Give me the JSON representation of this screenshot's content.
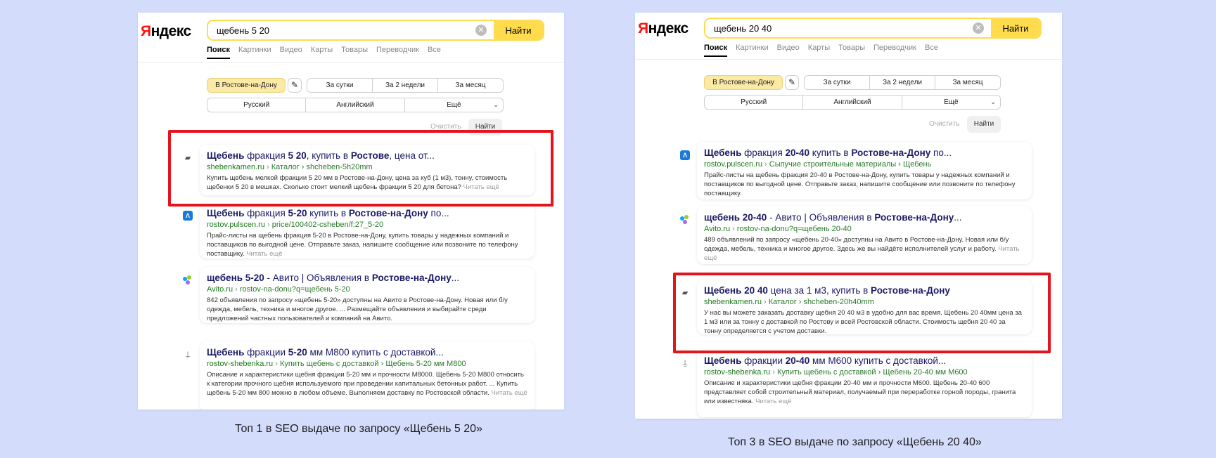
{
  "left": {
    "logo": "Яндекс",
    "search_value": "щебень 5 20",
    "search_button": "Найти",
    "tabs": [
      "Поиск",
      "Картинки",
      "Видео",
      "Карты",
      "Товары",
      "Переводчик",
      "Все"
    ],
    "filters": {
      "region": "В Ростове-на-Дону",
      "periods": [
        "За сутки",
        "За 2 недели",
        "За месяц"
      ],
      "languages": [
        "Русский",
        "Английский",
        "Ещё"
      ],
      "clear": "Очистить",
      "find": "Найти"
    },
    "results": [
      {
        "title": "Щебень фракция 5 20, купить в Ростове, цена от...",
        "site": "shebenkamen.ru",
        "path": "Каталог › shcheben-5h20mm",
        "snippet": "Купить щебень мелкой фракции 5 20 мм в Ростове-на-Дону, цена за куб (1 м3), тонну, стоимость щебенки 5 20 в мешках. Сколько стоит мелкий щебень фракции 5 20 для бетона?",
        "more": "Читать ещё"
      },
      {
        "title": "Щебень фракция 5-20 купить в Ростове-на-Дону по...",
        "site": "rostov.pulscen.ru",
        "path": "price/100402-csheben/f:27_5-20",
        "snippet": "Прайс-листы на щебень фракция 5-20 в Ростове-на-Дону, купить товары у надежных компаний и поставщиков по выгодной цене. Отправьте заказ, напишите сообщение или позвоните по телефону поставщику.",
        "more": "Читать ещё"
      },
      {
        "title": "щебень 5-20 - Авито | Объявления в Ростове-на-Дону...",
        "site": "Avito.ru",
        "path": "rostov-na-donu?q=щебень 5-20",
        "snippet": "842 объявления по запросу «щебень 5-20» доступны на Авито в Ростове-на-Дону. Новая или б/у одежда, мебель, техника и многое другое. ... Размещайте объявления и выбирайте среди предложений частных пользователей и компаний на Авито.",
        "more": ""
      },
      {
        "title": "Щебень фракции 5-20 мм М800 купить с доставкой...",
        "site": "rostov-shebenka.ru",
        "path": "Купить щебень с доставкой › Щебень 5-20 мм М800",
        "snippet": "Описание и характеристики щебня фракции 5-20 мм и прочности М8000. Щебень 5-20 М800 относить к категории прочного щебня используемого при проведении капитальных бетонных работ. ... Купить щебень 5-20 мм 800 можно в любом объеме. Выполняем доставку по Ростовской области.",
        "more": "Читать ещё"
      }
    ],
    "caption": "Топ 1 в SEO выдаче по запросу «Щебень 5 20»"
  },
  "right": {
    "logo": "Яндекс",
    "search_value": "щебень 20 40",
    "search_button": "Найти",
    "tabs": [
      "Поиск",
      "Картинки",
      "Видео",
      "Карты",
      "Товары",
      "Переводчик",
      "Все"
    ],
    "filters": {
      "region": "В Ростове-на-Дону",
      "periods": [
        "За сутки",
        "За 2 недели",
        "За месяц"
      ],
      "languages": [
        "Русский",
        "Английский",
        "Ещё"
      ],
      "clear": "Очистить",
      "find": "Найти"
    },
    "results": [
      {
        "title": "Щебень фракция 20-40 купить в Ростове-на-Дону по...",
        "site": "rostov.pulscen.ru",
        "path": "Сыпучие строительные материалы › Щебень",
        "snippet": "Прайс-листы на щебень фракция 20-40 в Ростове-на-Дону, купить товары у надежных компаний и поставщиков по выгодной цене. Отправьте заказ, напишите сообщение или позвоните по телефону поставщику.",
        "more": ""
      },
      {
        "title": "щебень 20-40 - Авито | Объявления в Ростове-на-Дону...",
        "site": "Avito.ru",
        "path": "rostov-na-donu?q=щебень 20-40",
        "snippet": "489 объявлений по запросу «щебень 20-40» доступны на Авито в Ростове-на-Дону. Новая или б/у одежда, мебель, техника и многое другое. Здесь же вы найдёте исполнителей услуг и работу.",
        "more": "Читать ещё"
      },
      {
        "title": "Щебень 20 40 цена за 1 м3, купить в Ростове-на-Дону",
        "site": "shebenkamen.ru",
        "path": "Каталог › shcheben-20h40mm",
        "snippet": "У нас вы можете заказать доставку щебня 20 40 м3 в удобно для вас время. Щебень 20 40мм цена за 1 м3 или за тонну с доставкой по Ростову и всей Ростовской области. Стоимость щебня 20 40 за тонну определяется с учетом доставки.",
        "more": ""
      },
      {
        "title": "Щебень фракции 20-40 мм М600 купить с доставкой...",
        "site": "rostov-shebenka.ru",
        "path": "Купить щебень с доставкой › Щебень 20-40 мм М600",
        "snippet": "Описание и характеристики щебня фракции 20-40 мм и прочности М600. Щебень 20-40 600 представляет собой строительный материал, получаемый при переработке горной породы, гранита или известняка.",
        "more": "Читать ещё"
      }
    ],
    "caption": "Топ 3 в SEO выдаче по запросу «Щебень 20 40»"
  },
  "colors": {
    "background": "#d3dcfb",
    "highlight": "#e3141b",
    "search_accent": "#ffdb4d",
    "title": "#1a1a66",
    "url": "#1c7a1c"
  },
  "icons": {
    "clear": "close-icon",
    "edit": "edit-icon",
    "chevron": "chevron-down-icon",
    "shebenkamen": "truck-icon",
    "pulscen": "pulscen-icon",
    "avito": "avito-dots-icon",
    "shebenka": "pin-icon"
  }
}
